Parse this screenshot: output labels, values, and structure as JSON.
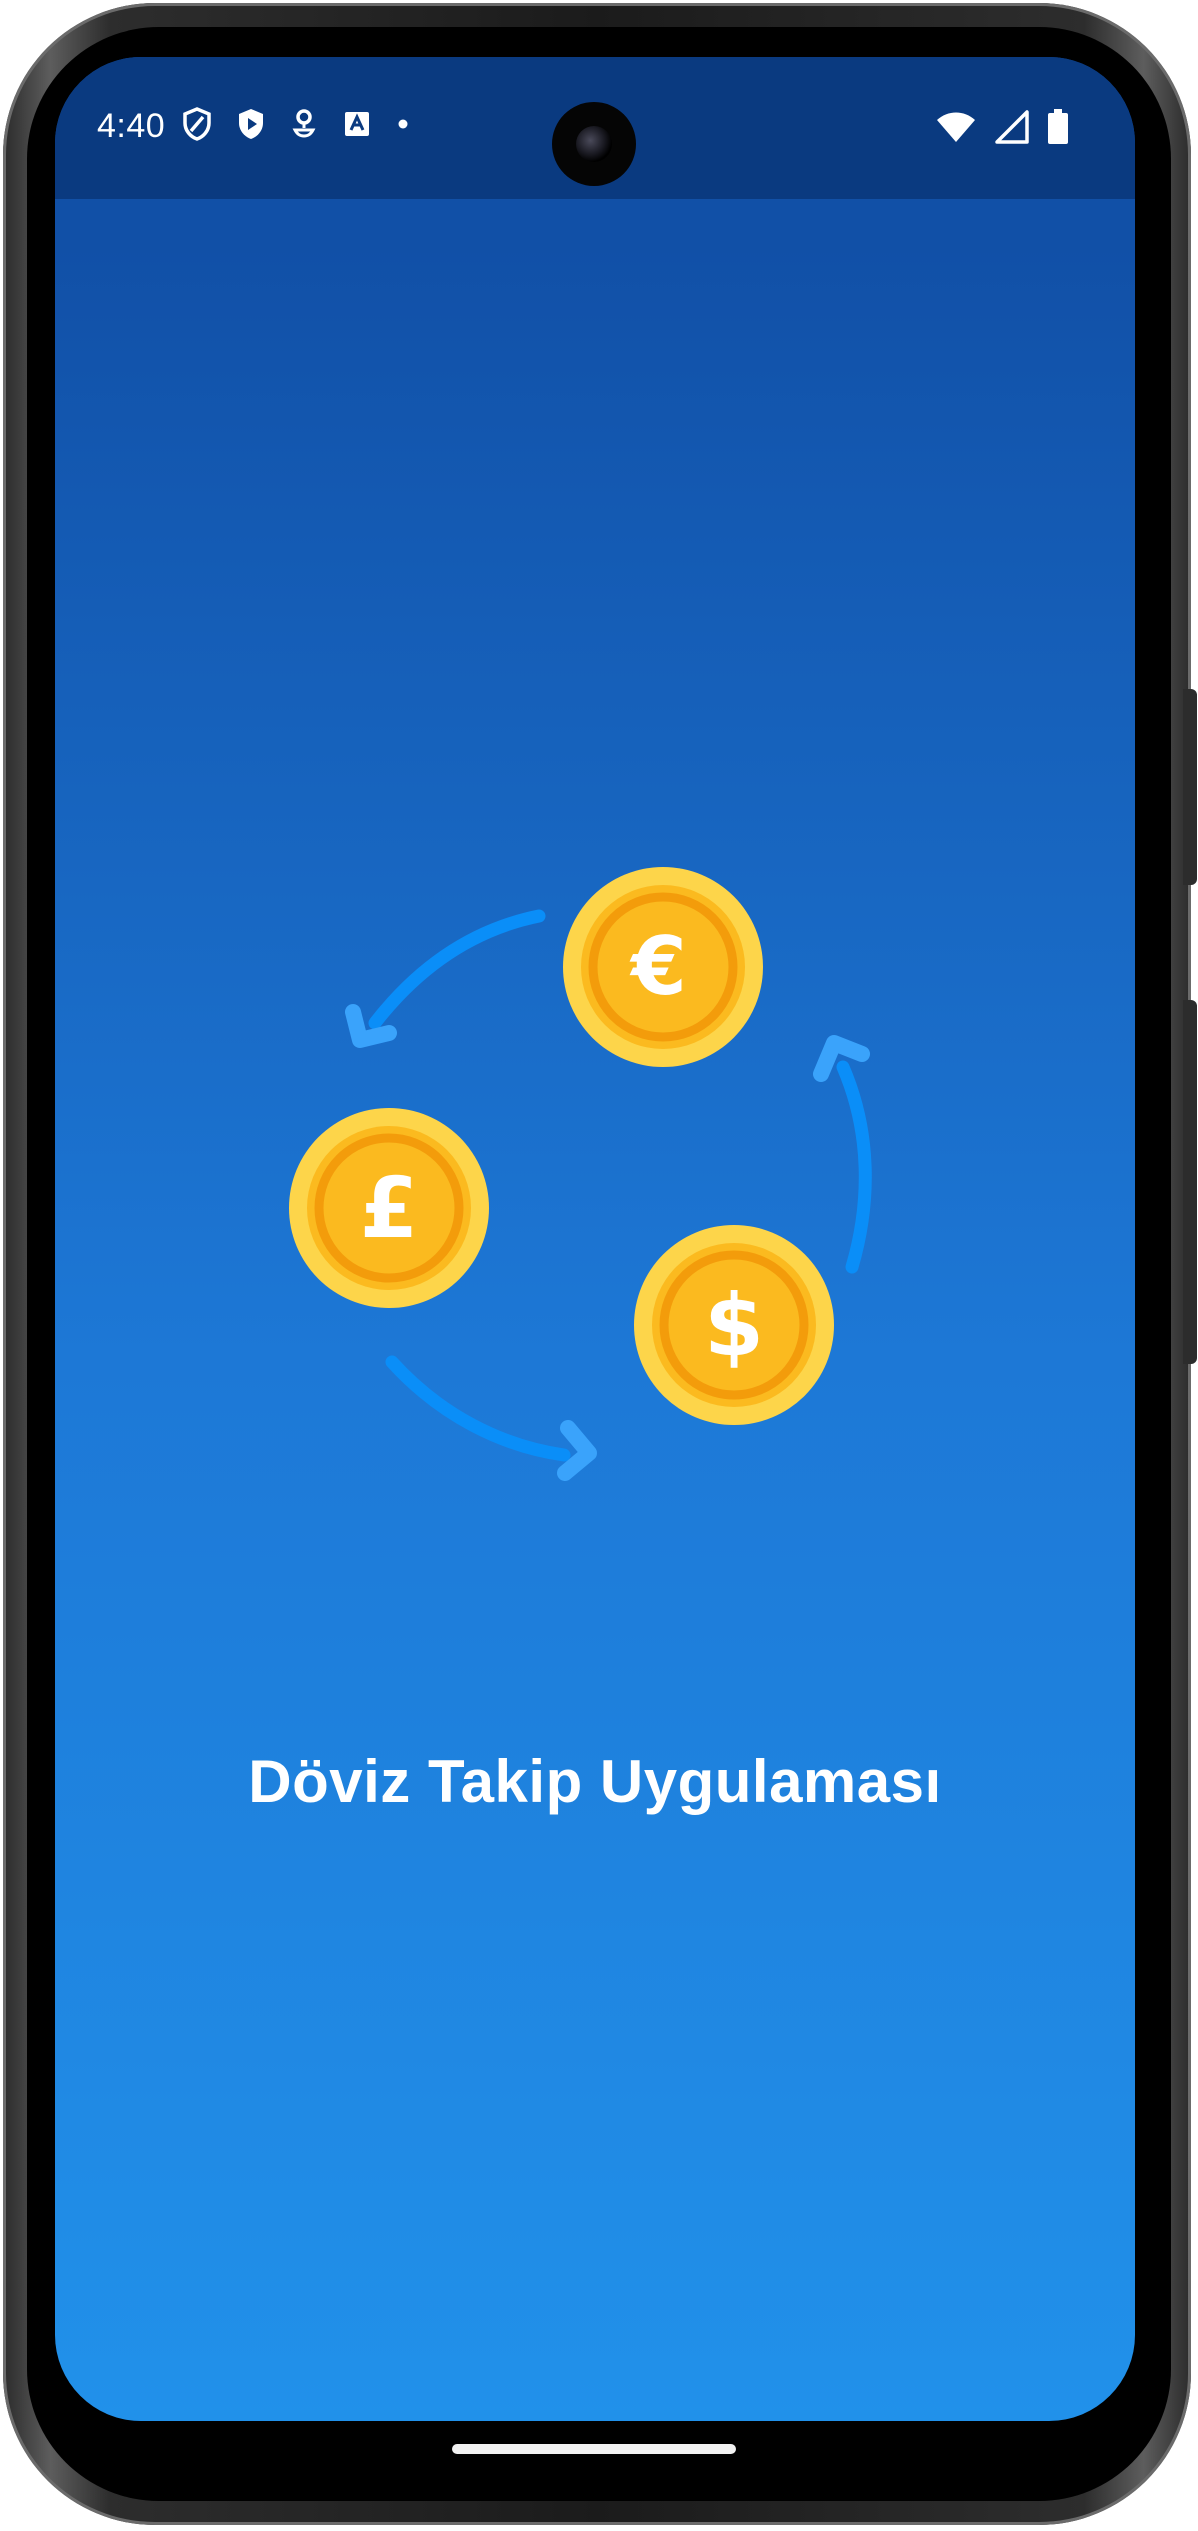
{
  "status_bar": {
    "time": "4:40",
    "left_icons": [
      "shield-icon",
      "play-protect-icon",
      "location-pin-icon",
      "translate-icon",
      "dot-icon"
    ],
    "right_icons": [
      "wifi-icon",
      "signal-icon",
      "battery-icon"
    ]
  },
  "splash": {
    "title": "Döviz Takip Uygulaması",
    "coins": [
      {
        "name": "euro-coin",
        "symbol": "€"
      },
      {
        "name": "pound-coin",
        "symbol": "£"
      },
      {
        "name": "dollar-coin",
        "symbol": "$"
      }
    ],
    "colors": {
      "background_top": "#1150a7",
      "background_bottom": "#2191ea",
      "status_bar": "#0a3a80",
      "coin_outer": "#fdd54a",
      "coin_inner": "#fbba1f",
      "coin_ring": "#f39c0b",
      "arrow": "#0a8ef8",
      "title_text": "#ffffff"
    }
  }
}
